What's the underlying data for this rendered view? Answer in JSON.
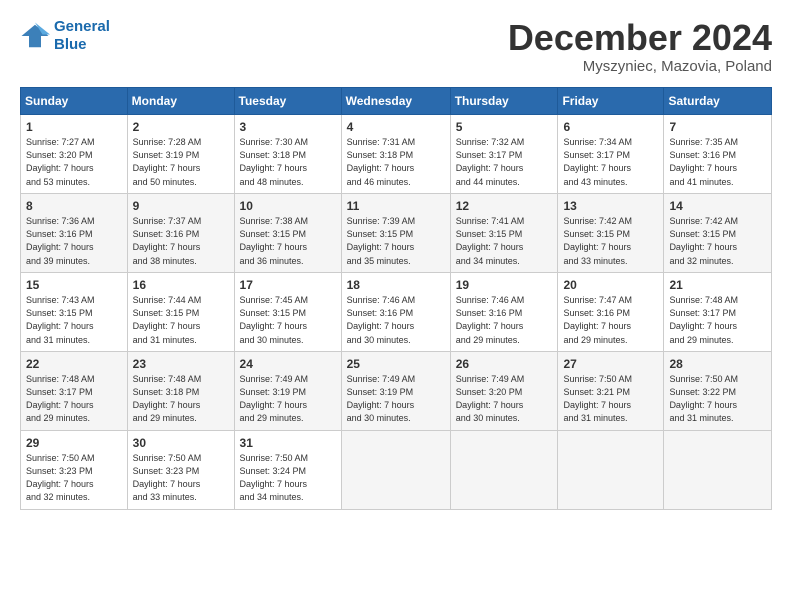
{
  "logo": {
    "line1": "General",
    "line2": "Blue"
  },
  "title": "December 2024",
  "location": "Myszyniec, Mazovia, Poland",
  "headers": [
    "Sunday",
    "Monday",
    "Tuesday",
    "Wednesday",
    "Thursday",
    "Friday",
    "Saturday"
  ],
  "rows": [
    [
      {
        "day": "1",
        "info": "Sunrise: 7:27 AM\nSunset: 3:20 PM\nDaylight: 7 hours\nand 53 minutes."
      },
      {
        "day": "2",
        "info": "Sunrise: 7:28 AM\nSunset: 3:19 PM\nDaylight: 7 hours\nand 50 minutes."
      },
      {
        "day": "3",
        "info": "Sunrise: 7:30 AM\nSunset: 3:18 PM\nDaylight: 7 hours\nand 48 minutes."
      },
      {
        "day": "4",
        "info": "Sunrise: 7:31 AM\nSunset: 3:18 PM\nDaylight: 7 hours\nand 46 minutes."
      },
      {
        "day": "5",
        "info": "Sunrise: 7:32 AM\nSunset: 3:17 PM\nDaylight: 7 hours\nand 44 minutes."
      },
      {
        "day": "6",
        "info": "Sunrise: 7:34 AM\nSunset: 3:17 PM\nDaylight: 7 hours\nand 43 minutes."
      },
      {
        "day": "7",
        "info": "Sunrise: 7:35 AM\nSunset: 3:16 PM\nDaylight: 7 hours\nand 41 minutes."
      }
    ],
    [
      {
        "day": "8",
        "info": "Sunrise: 7:36 AM\nSunset: 3:16 PM\nDaylight: 7 hours\nand 39 minutes."
      },
      {
        "day": "9",
        "info": "Sunrise: 7:37 AM\nSunset: 3:16 PM\nDaylight: 7 hours\nand 38 minutes."
      },
      {
        "day": "10",
        "info": "Sunrise: 7:38 AM\nSunset: 3:15 PM\nDaylight: 7 hours\nand 36 minutes."
      },
      {
        "day": "11",
        "info": "Sunrise: 7:39 AM\nSunset: 3:15 PM\nDaylight: 7 hours\nand 35 minutes."
      },
      {
        "day": "12",
        "info": "Sunrise: 7:41 AM\nSunset: 3:15 PM\nDaylight: 7 hours\nand 34 minutes."
      },
      {
        "day": "13",
        "info": "Sunrise: 7:42 AM\nSunset: 3:15 PM\nDaylight: 7 hours\nand 33 minutes."
      },
      {
        "day": "14",
        "info": "Sunrise: 7:42 AM\nSunset: 3:15 PM\nDaylight: 7 hours\nand 32 minutes."
      }
    ],
    [
      {
        "day": "15",
        "info": "Sunrise: 7:43 AM\nSunset: 3:15 PM\nDaylight: 7 hours\nand 31 minutes."
      },
      {
        "day": "16",
        "info": "Sunrise: 7:44 AM\nSunset: 3:15 PM\nDaylight: 7 hours\nand 31 minutes."
      },
      {
        "day": "17",
        "info": "Sunrise: 7:45 AM\nSunset: 3:15 PM\nDaylight: 7 hours\nand 30 minutes."
      },
      {
        "day": "18",
        "info": "Sunrise: 7:46 AM\nSunset: 3:16 PM\nDaylight: 7 hours\nand 30 minutes."
      },
      {
        "day": "19",
        "info": "Sunrise: 7:46 AM\nSunset: 3:16 PM\nDaylight: 7 hours\nand 29 minutes."
      },
      {
        "day": "20",
        "info": "Sunrise: 7:47 AM\nSunset: 3:16 PM\nDaylight: 7 hours\nand 29 minutes."
      },
      {
        "day": "21",
        "info": "Sunrise: 7:48 AM\nSunset: 3:17 PM\nDaylight: 7 hours\nand 29 minutes."
      }
    ],
    [
      {
        "day": "22",
        "info": "Sunrise: 7:48 AM\nSunset: 3:17 PM\nDaylight: 7 hours\nand 29 minutes."
      },
      {
        "day": "23",
        "info": "Sunrise: 7:48 AM\nSunset: 3:18 PM\nDaylight: 7 hours\nand 29 minutes."
      },
      {
        "day": "24",
        "info": "Sunrise: 7:49 AM\nSunset: 3:19 PM\nDaylight: 7 hours\nand 29 minutes."
      },
      {
        "day": "25",
        "info": "Sunrise: 7:49 AM\nSunset: 3:19 PM\nDaylight: 7 hours\nand 30 minutes."
      },
      {
        "day": "26",
        "info": "Sunrise: 7:49 AM\nSunset: 3:20 PM\nDaylight: 7 hours\nand 30 minutes."
      },
      {
        "day": "27",
        "info": "Sunrise: 7:50 AM\nSunset: 3:21 PM\nDaylight: 7 hours\nand 31 minutes."
      },
      {
        "day": "28",
        "info": "Sunrise: 7:50 AM\nSunset: 3:22 PM\nDaylight: 7 hours\nand 31 minutes."
      }
    ],
    [
      {
        "day": "29",
        "info": "Sunrise: 7:50 AM\nSunset: 3:23 PM\nDaylight: 7 hours\nand 32 minutes."
      },
      {
        "day": "30",
        "info": "Sunrise: 7:50 AM\nSunset: 3:23 PM\nDaylight: 7 hours\nand 33 minutes."
      },
      {
        "day": "31",
        "info": "Sunrise: 7:50 AM\nSunset: 3:24 PM\nDaylight: 7 hours\nand 34 minutes."
      },
      {
        "day": "",
        "info": ""
      },
      {
        "day": "",
        "info": ""
      },
      {
        "day": "",
        "info": ""
      },
      {
        "day": "",
        "info": ""
      }
    ]
  ]
}
